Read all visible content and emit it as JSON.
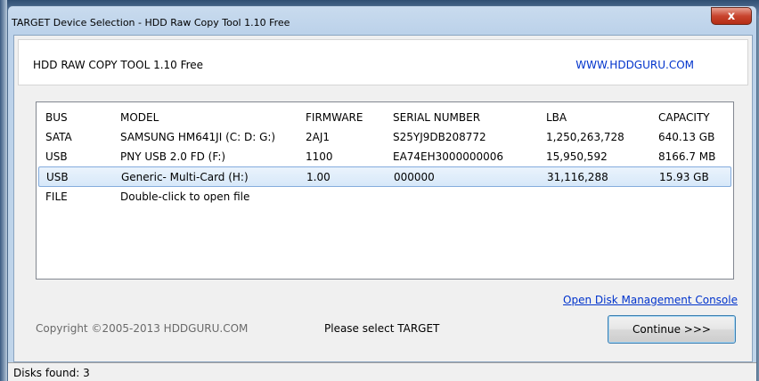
{
  "window": {
    "title": "TARGET Device Selection - HDD Raw Copy Tool 1.10   Free",
    "close_glyph": "x"
  },
  "header": {
    "app_name": "HDD RAW COPY TOOL 1.10   Free",
    "site_link": "WWW.HDDGURU.COM"
  },
  "device_list": {
    "columns": [
      "BUS",
      "MODEL",
      "FIRMWARE",
      "SERIAL NUMBER",
      "LBA",
      "CAPACITY"
    ],
    "rows": [
      {
        "bus": "SATA",
        "model": "SAMSUNG HM641JI (C: D: G:)",
        "firmware": "2AJ1",
        "serial": "S25YJ9DB208772",
        "lba": "1,250,263,728",
        "capacity": "640.13 GB"
      },
      {
        "bus": "USB",
        "model": "PNY USB 2.0 FD (F:)",
        "firmware": "1100",
        "serial": "EA74EH3000000006",
        "lba": "15,950,592",
        "capacity": "8166.7 MB"
      },
      {
        "bus": "USB",
        "model": "Generic- Multi-Card (H:)",
        "firmware": "1.00",
        "serial": "000000",
        "lba": "31,116,288",
        "capacity": "15.93 GB"
      },
      {
        "bus": "FILE",
        "model": "Double-click to open file",
        "firmware": "",
        "serial": "",
        "lba": "",
        "capacity": ""
      }
    ],
    "selected_row": 2
  },
  "links": {
    "disk_management": "Open Disk Management Console"
  },
  "footer": {
    "copyright": "Copyright ©2005-2013 HDDGURU.COM",
    "status_message": "Please select TARGET",
    "continue_label": "Continue >>>"
  },
  "statusbar": {
    "text": "Disks found: 3"
  },
  "colors": {
    "link": "#0033cc",
    "selection_border": "#84acdd",
    "title_bar": "#bcd2ea"
  }
}
